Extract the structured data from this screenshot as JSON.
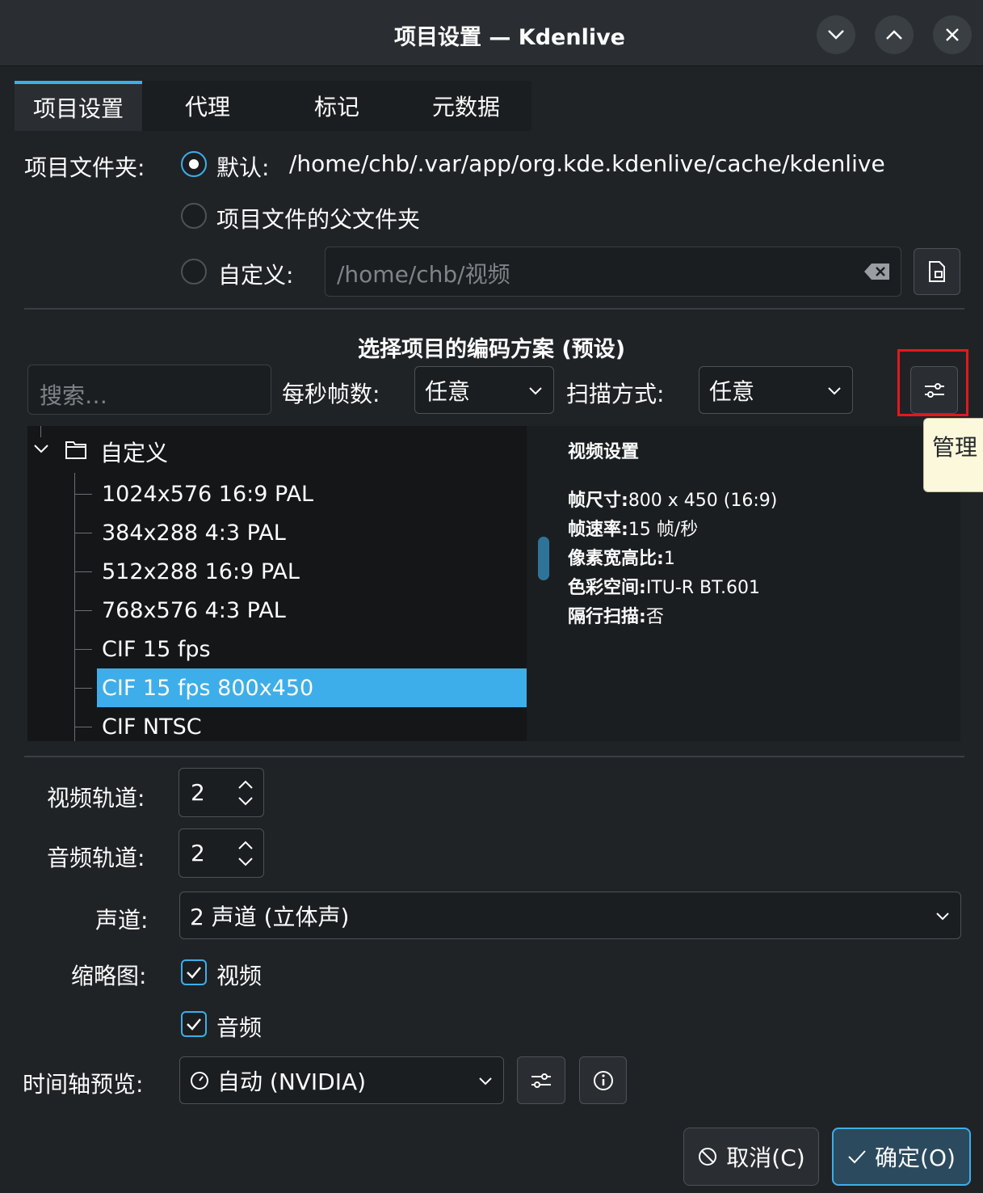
{
  "window": {
    "title": "项目设置 — Kdenlive"
  },
  "tabs": [
    {
      "label": "项目设置",
      "active": true
    },
    {
      "label": "代理",
      "active": false
    },
    {
      "label": "标记",
      "active": false
    },
    {
      "label": "元数据",
      "active": false
    }
  ],
  "folder": {
    "label": "项目文件夹:",
    "default_label": "默认:",
    "default_path": "/home/chb/.var/app/org.kde.kdenlive/cache/kdenlive",
    "parent_label": "项目文件的父文件夹",
    "custom_label": "自定义:",
    "custom_path": "/home/chb/视频"
  },
  "profile": {
    "heading": "选择项目的编码方案 (预设)",
    "search_placeholder": "搜索…",
    "fps_label": "每秒帧数:",
    "fps_value": "任意",
    "scan_label": "扫描方式:",
    "scan_value": "任意",
    "tooltip": "管理"
  },
  "tree": {
    "group": "自定义",
    "items": [
      "1024x576 16:9 PAL",
      "384x288 4:3 PAL",
      "512x288 16:9 PAL",
      "768x576 4:3 PAL",
      "CIF 15 fps",
      "CIF 15 fps 800x450",
      "CIF NTSC"
    ],
    "selected_index": 5
  },
  "video_info": {
    "title": "视频设置",
    "frame_size_label": "帧尺寸:",
    "frame_size": "800 x 450 (16:9)",
    "frame_rate_label": "帧速率:",
    "frame_rate": "15 帧/秒",
    "pixel_aspect_label": "像素宽高比:",
    "pixel_aspect": "1",
    "colorspace_label": "色彩空间:",
    "colorspace": "ITU-R BT.601",
    "interlaced_label": "隔行扫描:",
    "interlaced": "否"
  },
  "tracks": {
    "video_label": "视频轨道:",
    "video_value": "2",
    "audio_label": "音频轨道:",
    "audio_value": "2",
    "channels_label": "声道:",
    "channels_value": "2 声道 (立体声)",
    "thumbs_label": "缩略图:",
    "thumb_video": "视频",
    "thumb_audio": "音频",
    "preview_label": "时间轴预览:",
    "preview_value": "自动 (NVIDIA)"
  },
  "footer": {
    "cancel": "取消(C)",
    "ok": "确定(O)"
  },
  "colors": {
    "accent": "#3daee9",
    "background": "#202326",
    "highlight_box": "#e0191f"
  }
}
